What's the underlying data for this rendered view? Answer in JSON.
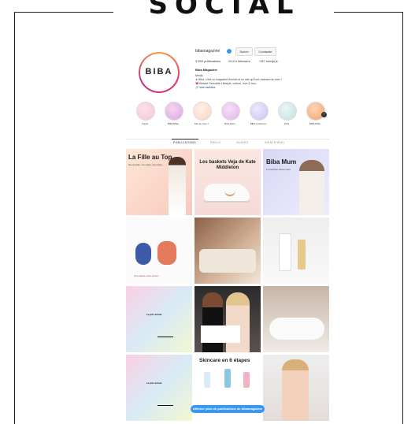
{
  "heading": "SOCIAL",
  "profile": {
    "avatar_text": "BIBA",
    "username": "bibamagazine",
    "follow_label": "Suivre",
    "contact_label": "Contacter",
    "stats": {
      "posts": "3 594 publications",
      "followers": "20,6 k followers",
      "following": "437 suivi(e)s"
    },
    "display_name": "Biba Magazine",
    "bio_lines": [
      "Média",
      "★ Biba, c'est un magazine féminin et un site qui font vraiment du bien !",
      "💗 Beauté Sexualité Lifestyle, culture, love & mor...",
      "🔗 web.me/biba"
    ]
  },
  "highlights": [
    {
      "label": "Travel",
      "color": "#f4c6d8"
    },
    {
      "label": "BIBASPEL",
      "color": "#e6b8ea"
    },
    {
      "label": "Ma vie rose ?",
      "color": "#fad4c0"
    },
    {
      "label": "Biba Mum",
      "color": "#e9c4ec"
    },
    {
      "label": "BIBA & Women",
      "color": "#d6d0f5"
    },
    {
      "label": "PSG",
      "color": "#cfe6e3"
    },
    {
      "label": "BIBASPEL",
      "color": "#f6b38b"
    }
  ],
  "tabs": [
    {
      "label": "PUBLICATIONS"
    },
    {
      "label": "REELS"
    },
    {
      "label": "GUIDES"
    },
    {
      "label": "IDENTIFIÉ(E)"
    }
  ],
  "posts": {
    "p1": {
      "title": "La Fille au Top",
      "text": "Sa réussite, son style, ses looks..."
    },
    "p2": {
      "title": "Les baskets Veja de Kate Middleton"
    },
    "p3": {
      "title": "Biba Mum",
      "text": "Le bonheur d'être mère"
    },
    "p4": {
      "text": "Une soirée entre amies"
    },
    "p7": {
      "text": "Le prix actuel"
    },
    "p10": {
      "text": "Le prix actuel"
    },
    "p11": {
      "title": "Skincare en 6 étapes"
    }
  },
  "see_more_label": "Afficher plus de publications de bibamagazine"
}
